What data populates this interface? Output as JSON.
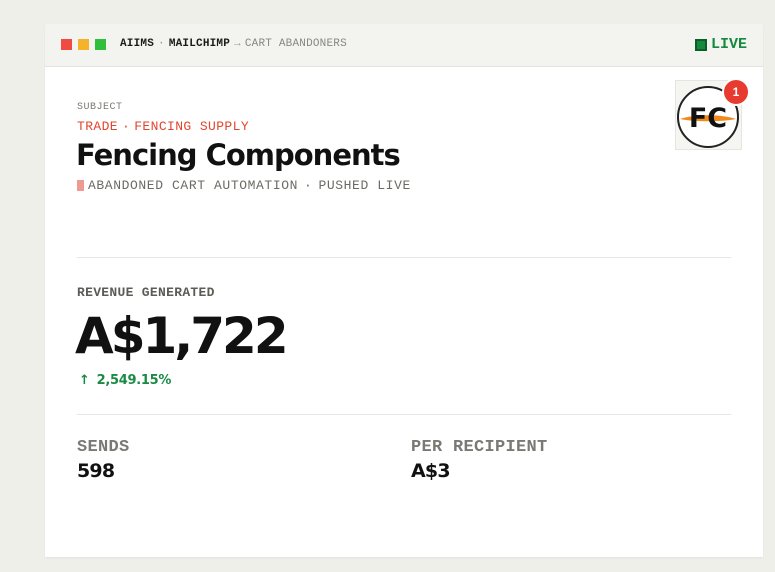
{
  "window": {
    "controls": [
      "close",
      "minimize",
      "maximize"
    ],
    "breadcrumb": {
      "account": "AIIMS",
      "platform": "MAILCHIMP",
      "sep_dot": "·",
      "sep_arrow": "→",
      "audience": "CART ABANDONERS"
    },
    "status": "LIVE"
  },
  "header": {
    "subject_label": "SUBJECT",
    "trade_label": "TRADE",
    "trade_sep": "·",
    "trade_value": "FENCING SUPPLY",
    "company_name": "Fencing Components",
    "automation_type": "ABANDONED CART AUTOMATION",
    "status_sep": "·",
    "automation_status": "PUSHED LIVE",
    "logo_text": "FC",
    "notification_count": "1"
  },
  "metrics": {
    "revenue_label": "REVENUE GENERATED",
    "revenue_value": "A$1,722",
    "change_arrow": "↑",
    "change_value": "2,549.15%",
    "sends_label": "SENDS",
    "sends_value": "598",
    "per_recipient_label": "PER RECIPIENT",
    "per_recipient_value": "A$3"
  },
  "colors": {
    "accent_red": "#e2452d",
    "live_green": "#138a3e",
    "positive_green": "#1a8a45",
    "badge_red": "#e83a2f",
    "logo_orange": "#f08a1c"
  }
}
